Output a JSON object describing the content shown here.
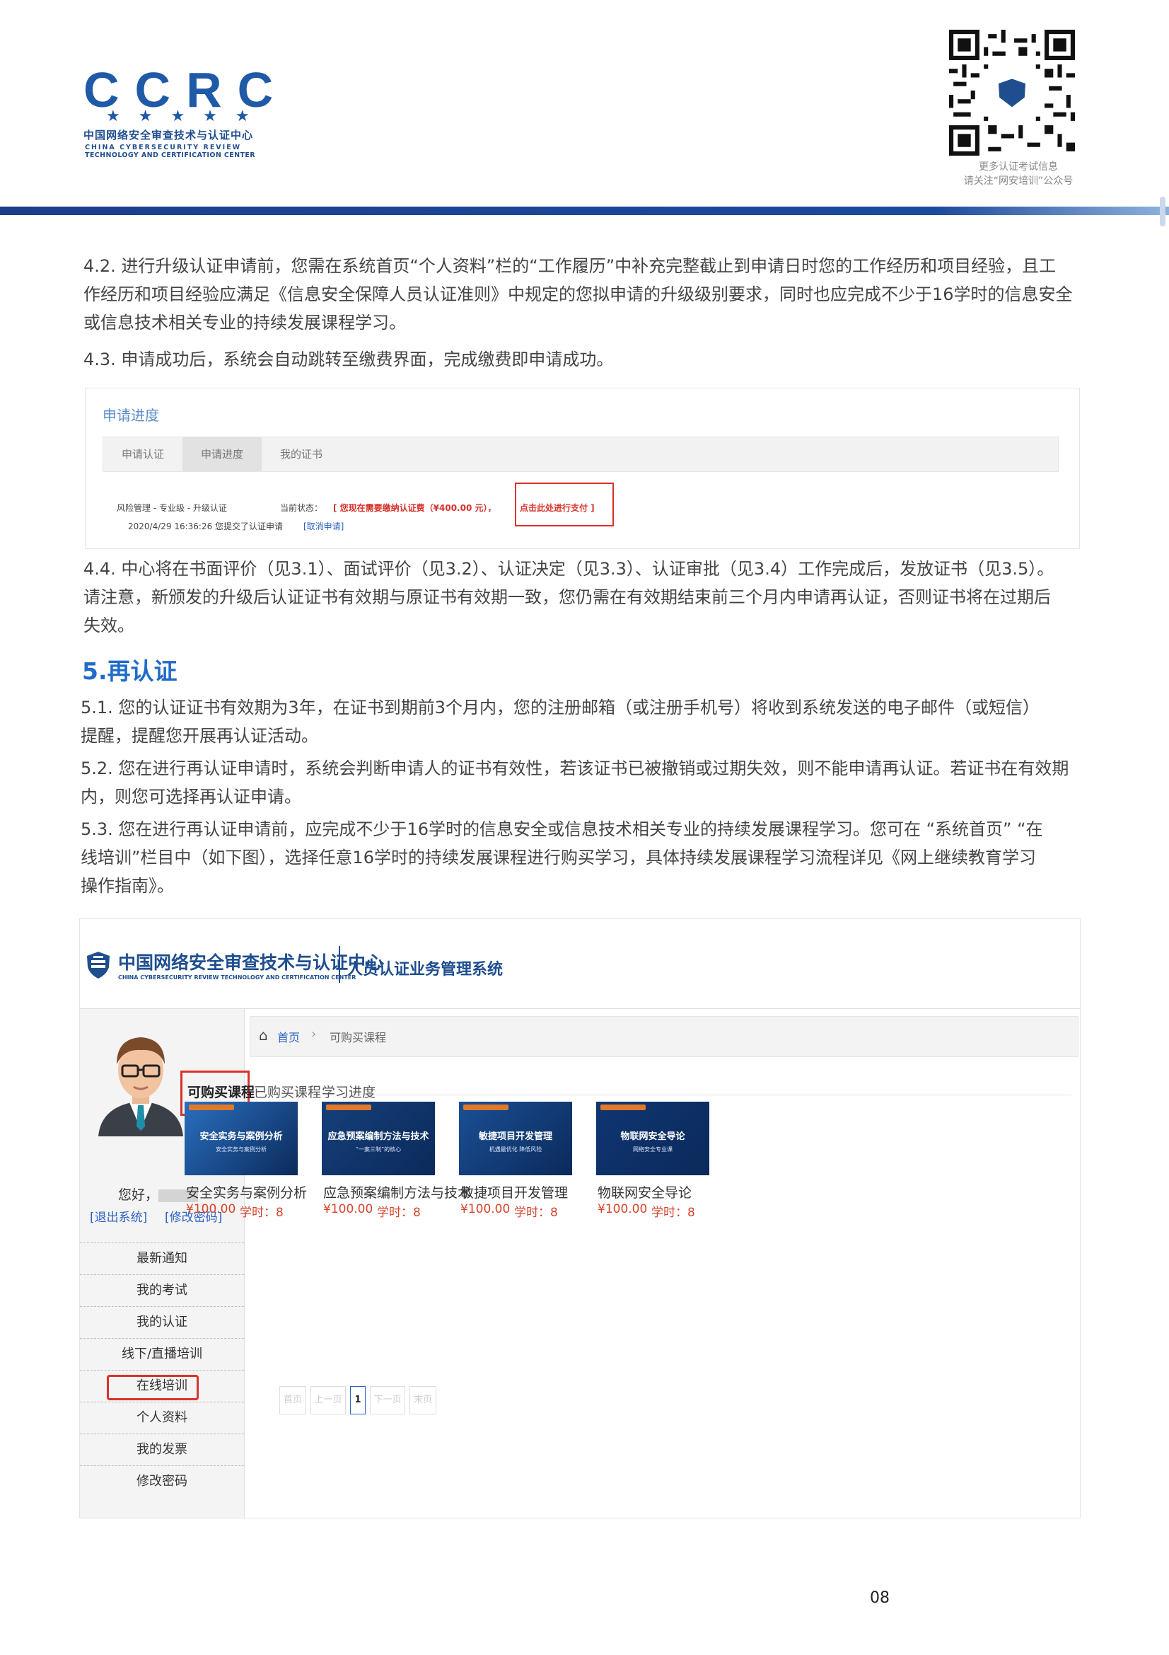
{
  "header": {
    "logo_letters": "CCRC",
    "logo_stars": "★★★★★",
    "logo_cn": "中国网络安全审查技术与认证中心",
    "logo_en_line1": "CHINA CYBERSECURITY REVIEW",
    "logo_en_line2": "TECHNOLOGY AND CERTIFICATION CENTER",
    "qr_caption_line1": "更多认证考试信息",
    "qr_caption_line2": "请关注“网安培训”公众号"
  },
  "para_4_2": {
    "line1": "4.2. 进行升级认证申请前，您需在系统首页“个人资料”栏的“工作履历”中补充完整截止到申请日时您的工作经历和项目经验，且工",
    "line2": "作经历和项目经验应满足《信息安全保障人员认证准则》中规定的您拟申请的升级级别要求，同时也应完成不少于16学时的信息安全",
    "line3": "或信息技术相关专业的持续发展课程学习。"
  },
  "para_4_3": "4.3. 申请成功后，系统会自动跳转至缴费界面，完成缴费即申请成功。",
  "screenshot1": {
    "title": "申请进度",
    "tabs": [
      "申请认证",
      "申请进度",
      "我的证书"
    ],
    "category": "风险管理 - 专业级 - 升级认证",
    "status_label": "当前状态：",
    "status_text": "[ 您现在需要缴纳认证费（¥400.00 元），",
    "pay_link": "点击此处进行支付 ]",
    "log_text": "2020/4/29 16:36:26  您提交了认证申请",
    "cancel_link": "[取消申请]"
  },
  "para_4_4": {
    "line1": "4.4. 中心将在书面评价（见3.1）、面试评价（见3.2）、认证决定（见3.3）、认证审批（见3.4）工作完成后，发放证书（见3.5）。",
    "line2": "请注意，新颁发的升级后认证证书有效期与原证书有效期一致，您仍需在有效期结束前三个月内申请再认证，否则证书将在过期后",
    "line3": "失效。"
  },
  "section5_title": "5.再认证",
  "para_5_1": {
    "line1": "5.1. 您的认证证书有效期为3年，在证书到期前3个月内，您的注册邮箱（或注册手机号）将收到系统发送的电子邮件（或短信）",
    "line2": "提醒，提醒您开展再认证活动。"
  },
  "para_5_2": {
    "line1": "5.2. 您在进行再认证申请时，系统会判断申请人的证书有效性，若该证书已被撤销或过期失效，则不能申请再认证。若证书在有效期",
    "line2": "内，则您可选择再认证申请。"
  },
  "para_5_3": {
    "line1": "5.3. 您在进行再认证申请前，应完成不少于16学时的信息安全或信息技术相关专业的持续发展课程学习。您可在 “系统首页” “在",
    "line2": "线培训”栏目中（如下图），选择任意16学时的持续发展课程进行购买学习，具体持续发展课程学习流程详见《网上继续教育学习",
    "line3": "操作指南》。"
  },
  "screenshot2": {
    "org_name": "中国网络安全审查技术与认证中心",
    "org_en": "CHINA CYBERSECURITY REVIEW TECHNOLOGY AND CERTIFICATION CENTER",
    "system_name": "人员认证业务管理系统",
    "greeting": "您好，",
    "logout": "[退出系统]",
    "change_pwd_link": "[修改密码]",
    "menu": [
      "最新通知",
      "我的考试",
      "我的认证",
      "线下/直播培训",
      "在线培训",
      "个人资料",
      "我的发票",
      "修改密码"
    ],
    "breadcrumb_home": "首页",
    "breadcrumb_sep": "›",
    "breadcrumb_current": "可购买课程",
    "tabs": [
      "可购买课程",
      "已购买课程",
      "学习进度"
    ],
    "courses": [
      {
        "cover_text": "安全实务与案例分析",
        "cover_sub": "安全实务与案例分析",
        "title": "安全实务与案例分析",
        "price": "¥100.00",
        "hours": "学时：8",
        "color": "#2a6fc0"
      },
      {
        "cover_text": "应急预案编制方法与技术",
        "cover_sub": "“一案三制”的核心",
        "title": "应急预案编制方法与技术",
        "price": "¥100.00",
        "hours": "学时：8",
        "color": "#153f7a"
      },
      {
        "cover_text": "敏捷项目开发管理",
        "cover_sub": "机遇最优化  降低风险",
        "title": "敏捷项目开发管理",
        "price": "¥100.00",
        "hours": "学时：8",
        "color": "#1a4f95"
      },
      {
        "cover_text": "物联网安全导论",
        "cover_sub": "网络安全专业课",
        "title": "物联网安全导论",
        "price": "¥100.00",
        "hours": "学时：8",
        "color": "#0f3572"
      }
    ],
    "pager": [
      "首页",
      "上一页",
      "1",
      "下一页",
      "末页"
    ]
  },
  "page_number": "08"
}
